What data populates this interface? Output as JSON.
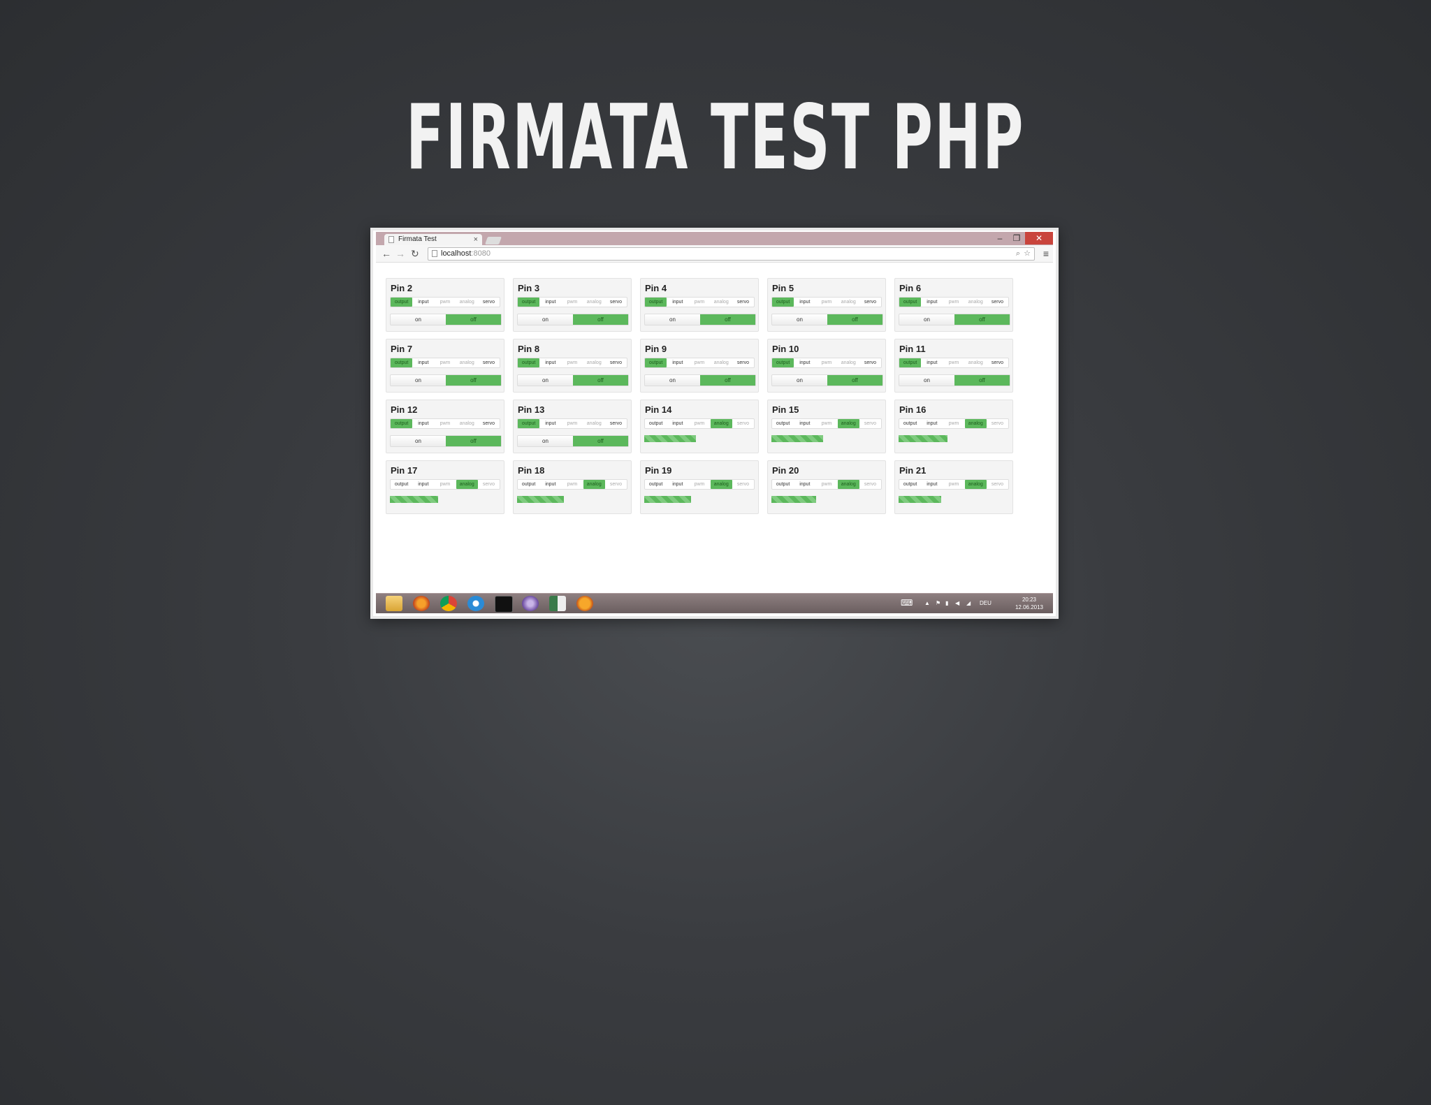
{
  "slide": {
    "title": "FIRMATA TEST PHP"
  },
  "browser": {
    "tab_title": "Firmata Test",
    "tab_close": "×",
    "url_host": "localhost",
    "url_port": ":8080",
    "window_buttons": {
      "minimize": "–",
      "restore": "❐",
      "close": "✕"
    }
  },
  "mode_labels": [
    "output",
    "input",
    "pwm",
    "analog",
    "servo"
  ],
  "pins": [
    {
      "name": "Pin 2",
      "mode": "output",
      "state": "off"
    },
    {
      "name": "Pin 3",
      "mode": "output",
      "state": "off"
    },
    {
      "name": "Pin 4",
      "mode": "output",
      "state": "off"
    },
    {
      "name": "Pin 5",
      "mode": "output",
      "state": "off"
    },
    {
      "name": "Pin 6",
      "mode": "output",
      "state": "off"
    },
    {
      "name": "Pin 7",
      "mode": "output",
      "state": "off"
    },
    {
      "name": "Pin 8",
      "mode": "output",
      "state": "off"
    },
    {
      "name": "Pin 9",
      "mode": "output",
      "state": "off"
    },
    {
      "name": "Pin 10",
      "mode": "output",
      "state": "off"
    },
    {
      "name": "Pin 11",
      "mode": "output",
      "state": "off"
    },
    {
      "name": "Pin 12",
      "mode": "output",
      "state": "off"
    },
    {
      "name": "Pin 13",
      "mode": "output",
      "state": "off"
    },
    {
      "name": "Pin 14",
      "mode": "analog",
      "value": 0.46
    },
    {
      "name": "Pin 15",
      "mode": "analog",
      "value": 0.46
    },
    {
      "name": "Pin 16",
      "mode": "analog",
      "value": 0.44
    },
    {
      "name": "Pin 17",
      "mode": "analog",
      "value": 0.43
    },
    {
      "name": "Pin 18",
      "mode": "analog",
      "value": 0.42
    },
    {
      "name": "Pin 19",
      "mode": "analog",
      "value": 0.42
    },
    {
      "name": "Pin 20",
      "mode": "analog",
      "value": 0.4
    },
    {
      "name": "Pin 21",
      "mode": "analog",
      "value": 0.38
    }
  ],
  "toggle": {
    "on": "on",
    "off": "off"
  },
  "taskbar": {
    "apps": [
      "file-explorer-icon",
      "firefox-icon",
      "chrome-icon",
      "internet-explorer-icon",
      "terminal-icon",
      "app-icon",
      "window-icon",
      "xampp-icon"
    ],
    "lang": "DEU",
    "time": "20:23",
    "date": "12.06.2013"
  },
  "colors": {
    "accent": "#5cb85c",
    "close": "#c9443c"
  }
}
